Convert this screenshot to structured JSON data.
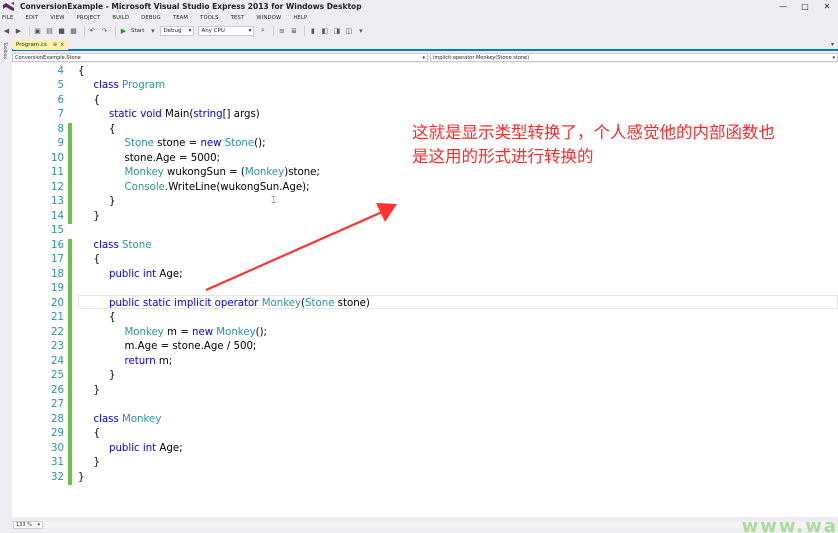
{
  "window": {
    "title": "ConversionExample - Microsoft Visual Studio Express 2013 for Windows Desktop",
    "controls": {
      "minimize": "—",
      "maximize": "□",
      "close": "✕"
    }
  },
  "menu": [
    "FILE",
    "EDIT",
    "VIEW",
    "PROJECT",
    "BUILD",
    "DEBUG",
    "TEAM",
    "TOOLS",
    "TEST",
    "WINDOW",
    "HELP"
  ],
  "toolbar": {
    "start_label": "Start",
    "config": "Debug",
    "platform": "Any CPU"
  },
  "toolbox_label": "Toolbox",
  "tab": {
    "label": "Program.cs",
    "pin": "⊕",
    "close": "×"
  },
  "nav": {
    "left": "ConversionExample.Stone",
    "right": "implicit operator Monkey(Stone stone)"
  },
  "code_lines": [
    {
      "n": "4",
      "indent": 0,
      "tokens": [
        [
          "pl",
          "{"
        ]
      ]
    },
    {
      "n": "5",
      "indent": 1,
      "tokens": [
        [
          "kw",
          "class "
        ],
        [
          "ty",
          "Program"
        ]
      ]
    },
    {
      "n": "6",
      "indent": 1,
      "tokens": [
        [
          "pl",
          "{"
        ]
      ]
    },
    {
      "n": "7",
      "indent": 2,
      "tokens": [
        [
          "kw",
          "static "
        ],
        [
          "kw",
          "void "
        ],
        [
          "pl",
          "Main("
        ],
        [
          "kw",
          "string"
        ],
        [
          "pl",
          "[] args)"
        ]
      ]
    },
    {
      "n": "8",
      "indent": 2,
      "tokens": [
        [
          "pl",
          "{"
        ]
      ]
    },
    {
      "n": "9",
      "indent": 3,
      "tokens": [
        [
          "ty",
          "Stone"
        ],
        [
          "pl",
          " stone = "
        ],
        [
          "kw",
          "new "
        ],
        [
          "ty",
          "Stone"
        ],
        [
          "pl",
          "();"
        ]
      ]
    },
    {
      "n": "10",
      "indent": 3,
      "tokens": [
        [
          "pl",
          "stone.Age = 5000;"
        ]
      ]
    },
    {
      "n": "11",
      "indent": 3,
      "tokens": [
        [
          "ty",
          "Monkey"
        ],
        [
          "pl",
          " wukongSun = ("
        ],
        [
          "ty",
          "Monkey"
        ],
        [
          "pl",
          ")stone;"
        ]
      ]
    },
    {
      "n": "12",
      "indent": 3,
      "tokens": [
        [
          "ty",
          "Console"
        ],
        [
          "pl",
          ".WriteLine(wukongSun.Age);"
        ]
      ]
    },
    {
      "n": "13",
      "indent": 2,
      "tokens": [
        [
          "pl",
          "}"
        ]
      ]
    },
    {
      "n": "14",
      "indent": 1,
      "tokens": [
        [
          "pl",
          "}"
        ]
      ]
    },
    {
      "n": "15",
      "indent": 0,
      "tokens": []
    },
    {
      "n": "16",
      "indent": 1,
      "tokens": [
        [
          "kw",
          "class "
        ],
        [
          "ty",
          "Stone"
        ]
      ]
    },
    {
      "n": "17",
      "indent": 1,
      "tokens": [
        [
          "pl",
          "{"
        ]
      ]
    },
    {
      "n": "18",
      "indent": 2,
      "tokens": [
        [
          "kw",
          "public "
        ],
        [
          "kw",
          "int "
        ],
        [
          "pl",
          "Age;"
        ]
      ]
    },
    {
      "n": "19",
      "indent": 0,
      "tokens": []
    },
    {
      "n": "20",
      "indent": 2,
      "tokens": [
        [
          "kw",
          "public "
        ],
        [
          "kw",
          "static "
        ],
        [
          "kw",
          "implicit "
        ],
        [
          "kw",
          "operator "
        ],
        [
          "ty",
          "Monkey"
        ],
        [
          "pl",
          "("
        ],
        [
          "ty",
          "Stone"
        ],
        [
          "pl",
          " stone)"
        ]
      ]
    },
    {
      "n": "21",
      "indent": 2,
      "tokens": [
        [
          "pl",
          "{"
        ]
      ]
    },
    {
      "n": "22",
      "indent": 3,
      "tokens": [
        [
          "ty",
          "Monkey"
        ],
        [
          "pl",
          " m = "
        ],
        [
          "kw",
          "new "
        ],
        [
          "ty",
          "Monkey"
        ],
        [
          "pl",
          "();"
        ]
      ]
    },
    {
      "n": "23",
      "indent": 3,
      "tokens": [
        [
          "pl",
          "m.Age = stone.Age / 500;"
        ]
      ]
    },
    {
      "n": "24",
      "indent": 3,
      "tokens": [
        [
          "kw",
          "return "
        ],
        [
          "pl",
          "m;"
        ]
      ]
    },
    {
      "n": "25",
      "indent": 2,
      "tokens": [
        [
          "pl",
          "}"
        ]
      ]
    },
    {
      "n": "26",
      "indent": 1,
      "tokens": [
        [
          "pl",
          "}"
        ]
      ]
    },
    {
      "n": "27",
      "indent": 0,
      "tokens": []
    },
    {
      "n": "28",
      "indent": 1,
      "tokens": [
        [
          "kw",
          "class "
        ],
        [
          "ty",
          "Monkey"
        ]
      ]
    },
    {
      "n": "29",
      "indent": 1,
      "tokens": [
        [
          "pl",
          "{"
        ]
      ]
    },
    {
      "n": "30",
      "indent": 2,
      "tokens": [
        [
          "kw",
          "public "
        ],
        [
          "kw",
          "int "
        ],
        [
          "pl",
          "Age;"
        ]
      ]
    },
    {
      "n": "31",
      "indent": 1,
      "tokens": [
        [
          "pl",
          "}"
        ]
      ]
    },
    {
      "n": "32",
      "indent": 0,
      "tokens": [
        [
          "pl",
          "}"
        ]
      ]
    }
  ],
  "changed_lines": [
    "8",
    "9",
    "10",
    "11",
    "12",
    "13",
    "14",
    "16",
    "17",
    "18",
    "19",
    "20",
    "21",
    "22",
    "23",
    "24",
    "25",
    "26",
    "27",
    "28",
    "29",
    "30",
    "31",
    "32"
  ],
  "annotation": {
    "line1": "这就是显示类型转换了，个人感觉他的内部函数也",
    "line2": "是这用的形式进行转换的"
  },
  "status": {
    "zoom": "133 %"
  },
  "watermark": "www.wa",
  "colors": {
    "keyword": "#0000ff",
    "type": "#2b91af",
    "line_number": "#2b91af",
    "change_margin": "#6cc24a",
    "annotation": "#ff2a2a",
    "accent": "#007acc"
  }
}
